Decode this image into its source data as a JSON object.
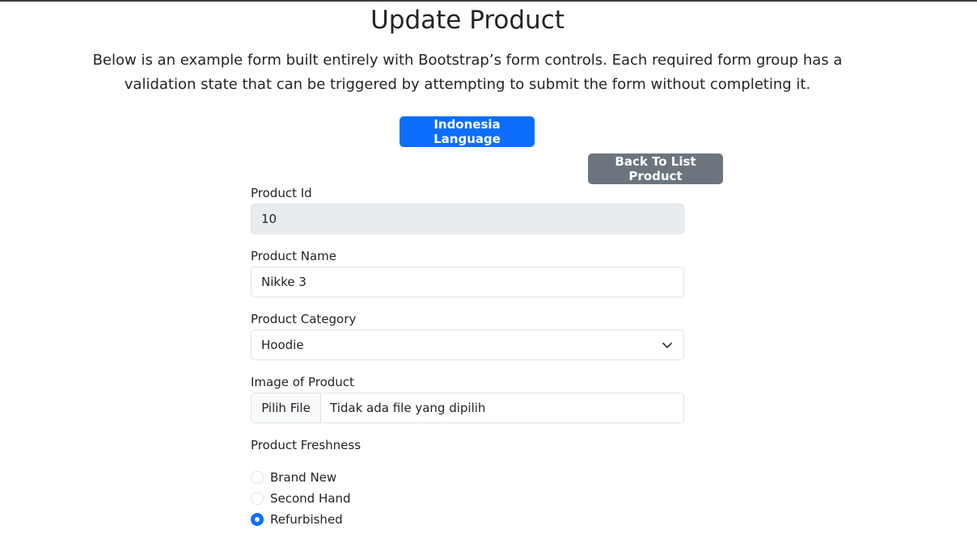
{
  "header": {
    "title": "Update Product",
    "lead": "Below is an example form built entirely with Bootstrap’s form controls. Each required form group has a validation state that can be triggered by attempting to submit the form without completing it."
  },
  "buttons": {
    "language": "Indonesia Language",
    "back": "Back To List Product"
  },
  "form": {
    "product_id": {
      "label": "Product Id",
      "value": "10"
    },
    "product_name": {
      "label": "Product Name",
      "value": "Nikke 3"
    },
    "product_category": {
      "label": "Product Category",
      "selected": "Hoodie"
    },
    "image": {
      "label": "Image of Product",
      "button": "Pilih File",
      "status": "Tidak ada file yang dipilih"
    },
    "freshness": {
      "label": "Product Freshness",
      "options": [
        {
          "label": "Brand New",
          "checked": false
        },
        {
          "label": "Second Hand",
          "checked": false
        },
        {
          "label": "Refurbished",
          "checked": true
        }
      ]
    }
  },
  "colors": {
    "primary": "#0d6efd",
    "secondary": "#6c757d",
    "disabled_bg": "#e9ecef",
    "border": "#dee2e6"
  }
}
